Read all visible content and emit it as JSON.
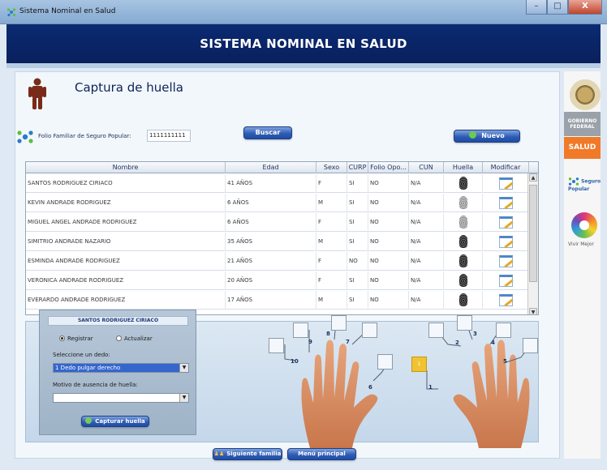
{
  "window": {
    "title": "Sistema Nominal en Salud",
    "min": "–",
    "max": "□",
    "close": "X"
  },
  "header": {
    "title": "SISTEMA NOMINAL EN SALUD"
  },
  "page": {
    "title": "Captura de huella"
  },
  "folio": {
    "label": "Folio Familiar de Seguro Popular:",
    "value": "1111111111"
  },
  "buttons": {
    "buscar": "Buscar",
    "nuevo": "Nuevo",
    "capturar": "Capturar huella",
    "siguiente": "Siguiente familia",
    "menu": "Menú principal"
  },
  "table": {
    "columns": [
      "Nombre",
      "Edad",
      "Sexo",
      "CURP",
      "Folio Opo...",
      "CUN",
      "Huella",
      "Modificar"
    ],
    "rows": [
      {
        "nombre": "SANTOS RODRIGUEZ CIRIACO",
        "edad": "41 AÑOS",
        "sexo": "F",
        "curp": "SI",
        "folio": "NO",
        "cun": "N/A",
        "huella": "dark"
      },
      {
        "nombre": "KEVIN ANDRADE RODRIGUEZ",
        "edad": "6 AÑOS",
        "sexo": "M",
        "curp": "SI",
        "folio": "NO",
        "cun": "N/A",
        "huella": "light"
      },
      {
        "nombre": "MIGUEL ANGEL ANDRADE RODRIGUEZ",
        "edad": "6 AÑOS",
        "sexo": "F",
        "curp": "SI",
        "folio": "NO",
        "cun": "N/A",
        "huella": "light"
      },
      {
        "nombre": "SIMITRIO ANDRADE NAZARIO",
        "edad": "35 AÑOS",
        "sexo": "M",
        "curp": "SI",
        "folio": "NO",
        "cun": "N/A",
        "huella": "dark"
      },
      {
        "nombre": "ESMINDA ANDRADE RODRIGUEZ",
        "edad": "21 AÑOS",
        "sexo": "F",
        "curp": "NO",
        "folio": "NO",
        "cun": "N/A",
        "huella": "dark"
      },
      {
        "nombre": "VERONICA ANDRADE RODRIGUEZ",
        "edad": "20 AÑOS",
        "sexo": "F",
        "curp": "SI",
        "folio": "NO",
        "cun": "N/A",
        "huella": "dark"
      },
      {
        "nombre": "EVERARDO ANDRADE RODRIGUEZ",
        "edad": "17 AÑOS",
        "sexo": "M",
        "curp": "SI",
        "folio": "NO",
        "cun": "N/A",
        "huella": "dark"
      }
    ]
  },
  "capture": {
    "person": "SANTOS RODRIGUEZ CIRIACO",
    "radio_registrar": "Registrar",
    "radio_actualizar": "Actualizar",
    "selected_mode": "Registrar",
    "finger_label": "Seleccione un dedo:",
    "finger_value": "1 Dedo pulgar derecho",
    "motivo_label": "Motivo de ausencia de huella:",
    "motivo_value": ""
  },
  "fingers": {
    "left": [
      "10",
      "9",
      "8",
      "7",
      "6"
    ],
    "right": [
      "1",
      "2",
      "3",
      "4",
      "5"
    ],
    "selected": "1"
  },
  "sidebar": {
    "gobierno": "GOBIERNO FEDERAL",
    "salud": "SALUD",
    "seguro": "Seguro Popular",
    "vivir": "Vivir Mejor"
  },
  "colors": {
    "header": "#0b2a72",
    "salud": "#f07a28",
    "selected_finger": "#f1c232",
    "button": "#2f5db6"
  }
}
